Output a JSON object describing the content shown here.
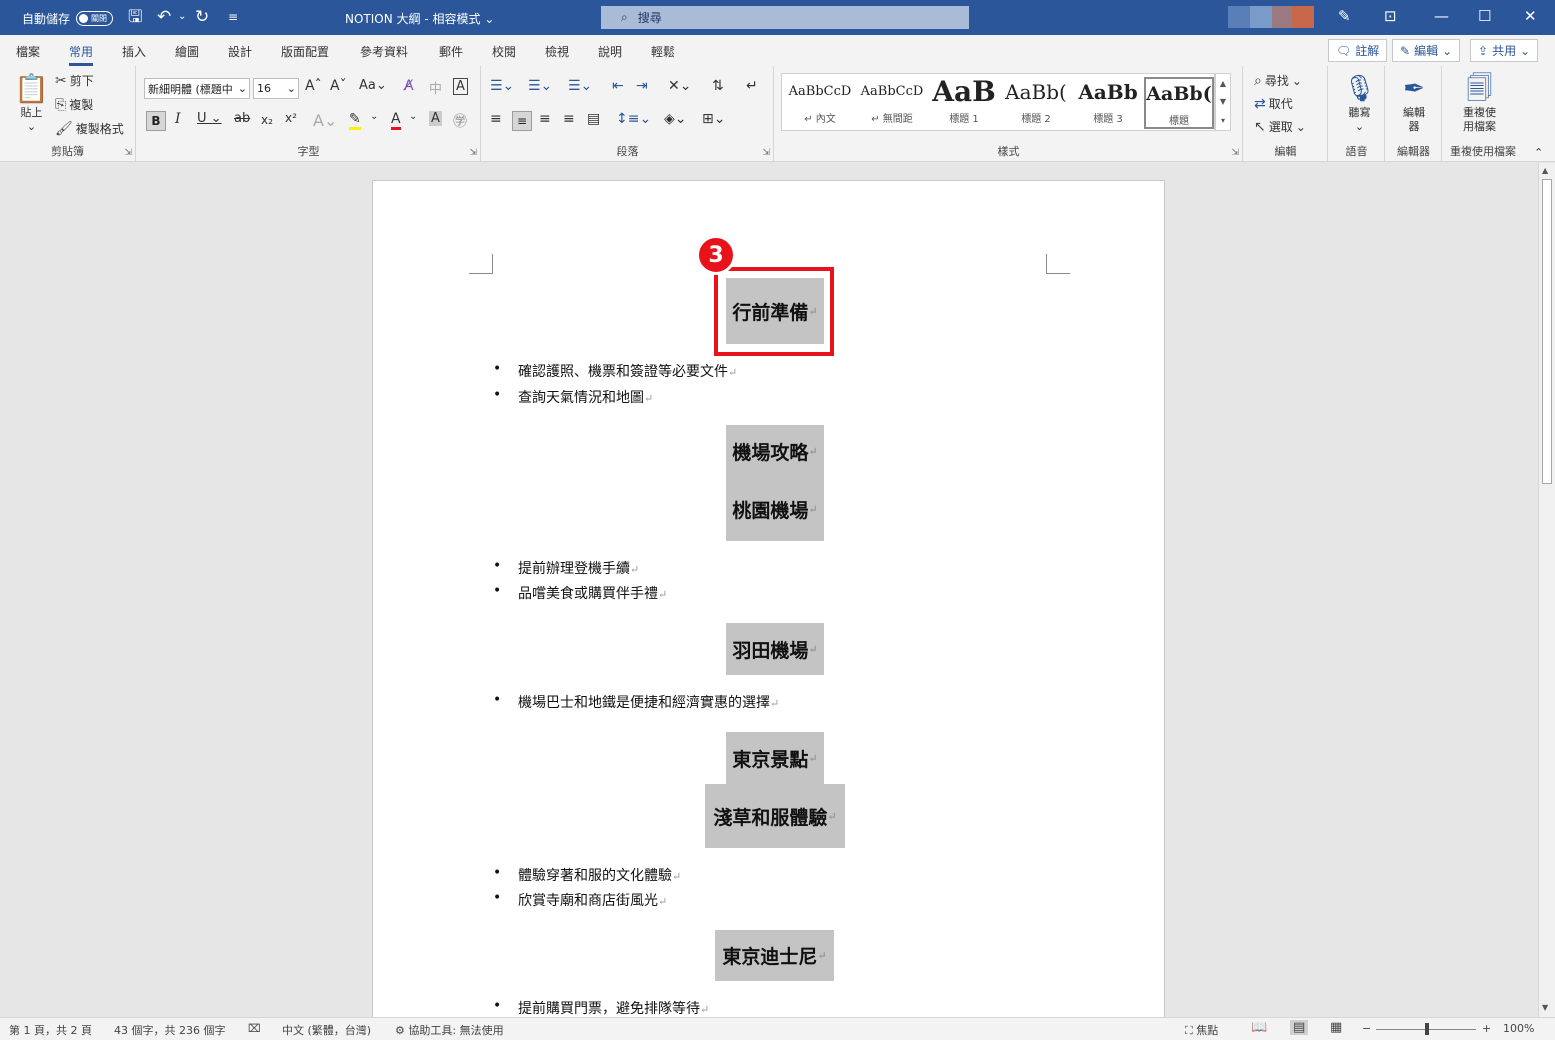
{
  "titlebar": {
    "autosave_label": "自動儲存",
    "autosave_state": "關閉",
    "document_title": "NOTION 大綱 - 相容模式",
    "search_placeholder": "搜尋"
  },
  "tabs": [
    "檔案",
    "常用",
    "插入",
    "繪圖",
    "設計",
    "版面配置",
    "參考資料",
    "郵件",
    "校閱",
    "檢視",
    "說明",
    "輕鬆"
  ],
  "active_tab": "常用",
  "ribbon_right": {
    "comments": "註解",
    "editing": "編輯",
    "share": "共用"
  },
  "clipboard": {
    "paste": "貼上",
    "cut": "剪下",
    "copy": "複製",
    "format_painter": "複製格式",
    "label": "剪貼簿"
  },
  "font": {
    "name": "新細明體 (標題中",
    "size": "16",
    "label": "字型"
  },
  "paragraph": {
    "label": "段落"
  },
  "styles": {
    "label": "樣式",
    "items": [
      {
        "preview": "AaBbCcD",
        "name": "內文"
      },
      {
        "preview": "AaBbCcD",
        "name": "無間距"
      },
      {
        "preview": "AaB",
        "name": "標題 1"
      },
      {
        "preview": "AaBb(",
        "name": "標題 2"
      },
      {
        "preview": "AaBb",
        "name": "標題 3"
      },
      {
        "preview": "AaBb(",
        "name": "標題"
      }
    ]
  },
  "editing": {
    "find": "尋找",
    "replace": "取代",
    "select": "選取",
    "label": "編輯"
  },
  "voice": {
    "dictate": "聽寫",
    "label": "語音"
  },
  "editor": {
    "button": "編輯器",
    "label": "編輯器"
  },
  "reuse": {
    "button_line1": "重複使",
    "button_line2": "用檔案",
    "label": "重複使用檔案"
  },
  "document": {
    "step_number": "3",
    "blocks": [
      {
        "type": "heading",
        "text": "行前準備"
      },
      {
        "type": "bullet",
        "text": "確認護照、機票和簽證等必要文件"
      },
      {
        "type": "bullet",
        "text": "查詢天氣情況和地圖"
      },
      {
        "type": "heading",
        "text": "機場攻略"
      },
      {
        "type": "heading",
        "text": "桃園機場"
      },
      {
        "type": "bullet",
        "text": "提前辦理登機手續"
      },
      {
        "type": "bullet",
        "text": "品嚐美食或購買伴手禮"
      },
      {
        "type": "heading",
        "text": "羽田機場"
      },
      {
        "type": "bullet",
        "text": "機場巴士和地鐵是便捷和經濟實惠的選擇"
      },
      {
        "type": "heading",
        "text": "東京景點"
      },
      {
        "type": "heading",
        "text": "淺草和服體驗"
      },
      {
        "type": "bullet",
        "text": "體驗穿著和服的文化體驗"
      },
      {
        "type": "bullet",
        "text": "欣賞寺廟和商店街風光"
      },
      {
        "type": "heading",
        "text": "東京迪士尼"
      },
      {
        "type": "bullet",
        "text": "提前購買門票，避免排隊等待"
      }
    ],
    "paragraph_mark": "↵"
  },
  "statusbar": {
    "page": "第 1 頁，共 2 頁",
    "words": "43 個字，共 236 個字",
    "language": "中文 (繁體，台灣)",
    "accessibility": "協助工具: 無法使用",
    "focus": "焦點",
    "zoom": "100%"
  }
}
